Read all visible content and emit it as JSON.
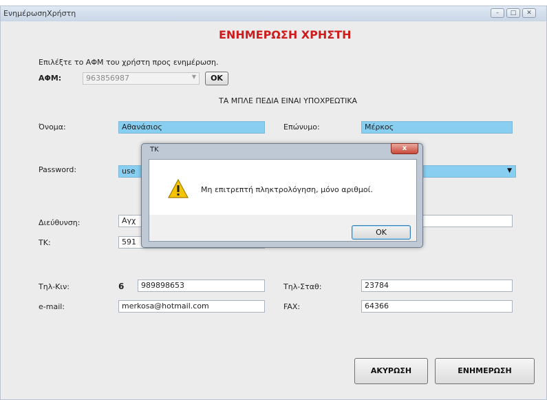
{
  "window": {
    "title": "ΕνημέρωσηΧρήστη",
    "controls": [
      "–",
      "□",
      "✕"
    ]
  },
  "form": {
    "heading": "ΕΝΗΜΕΡΩΣΗ ΧΡΗΣΤΗ",
    "instruction": "Επιλέξτε το ΑΦΜ του χρήστη προς ενημέρωση.",
    "afm_label": "ΑΦΜ:",
    "afm_value": "963856987",
    "ok_button": "OK",
    "required_note": "ΤΑ ΜΠΛΕ ΠΕΔΙΑ ΕΙΝΑΙ ΥΠΟΧΡΕΩΤΙΚΑ",
    "name_label": "Όνομα:",
    "name_value": "Αθανάσιος",
    "surname_label": "Επώνυμο:",
    "surname_value": "Μέρκος",
    "password_label": "Password:",
    "password_value": "use",
    "address_label": "Διεύθυνση:",
    "address_value": "Αγχ",
    "tk_label": "TK:",
    "tk_value": "591",
    "mobile_label": "Τηλ-Κιν:",
    "mobile_prefix": "6",
    "mobile_value": "989898653",
    "phone_label": "Τηλ-Σταθ:",
    "phone_value": "23784",
    "email_label": "e-mail:",
    "email_value": "merkosa@hotmail.com",
    "fax_label": "FAX:",
    "fax_value": "64366",
    "cancel_button": "ΑΚΥΡΩΣΗ",
    "update_button": "ΕΝΗΜΕΡΩΣΗ"
  },
  "dialog": {
    "title": "TK",
    "close": "x",
    "message": "Μη επιτρεπτή πληκτρολόγηση, μόνο αριθμοί.",
    "ok_button": "OK",
    "icon": "warning-icon"
  },
  "colors": {
    "required_field": "#87cef0",
    "heading": "#cc1c1c"
  }
}
